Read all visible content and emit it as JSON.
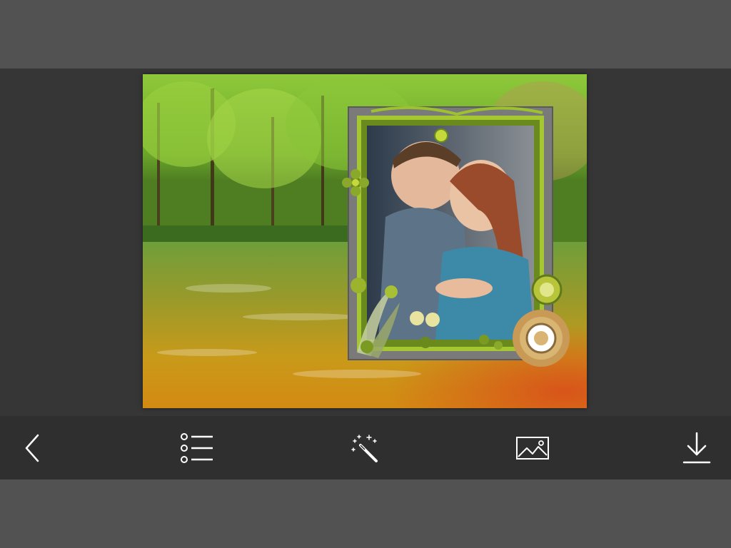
{
  "app": {
    "colors": {
      "band": "#525252",
      "workspace": "#363636",
      "toolbar": "#2f2f2f",
      "icon": "#ffffff"
    }
  },
  "canvas": {
    "background_scene": "forest-river",
    "frame_style": "green-grey-floral-frame",
    "photo_subject": "couple"
  },
  "toolbar": {
    "items": [
      {
        "icon": "back-chevron-icon"
      },
      {
        "icon": "list-icon"
      },
      {
        "icon": "magic-wand-icon"
      },
      {
        "icon": "image-icon"
      },
      {
        "icon": "download-icon"
      }
    ]
  }
}
